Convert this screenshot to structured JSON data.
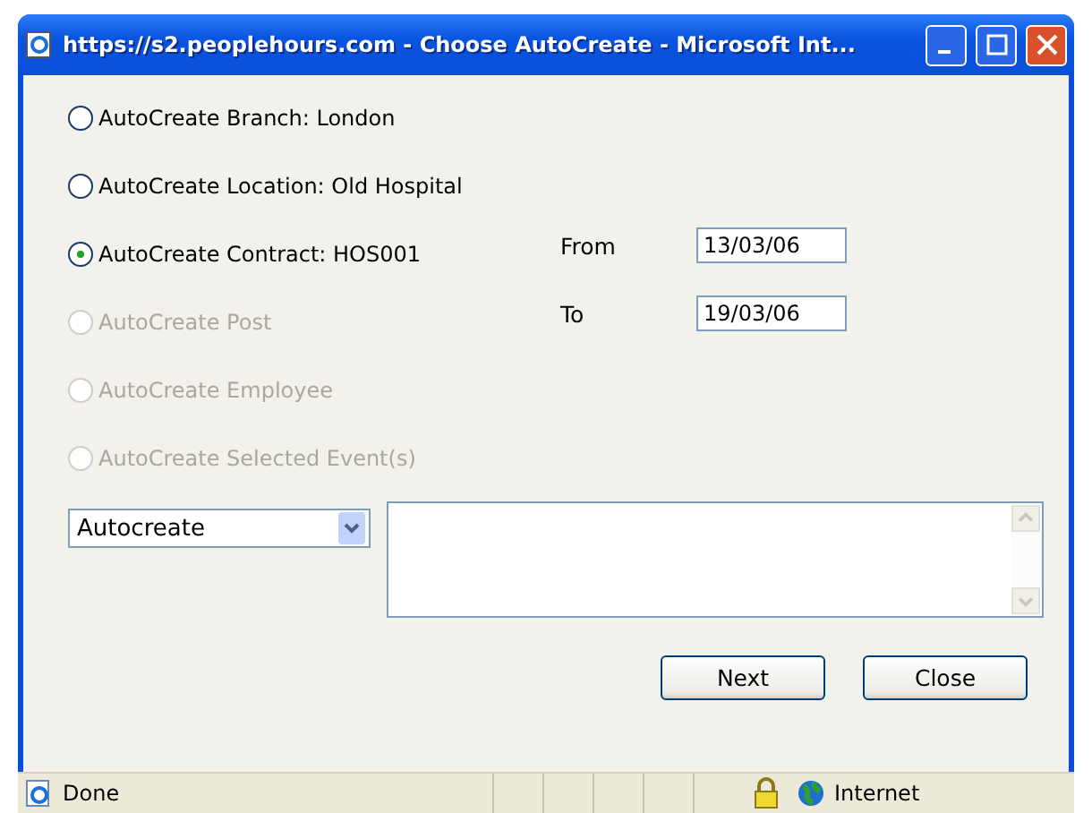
{
  "window": {
    "title": "https://s2.peoplehours.com - Choose AutoCreate - Microsoft Int..."
  },
  "options": [
    {
      "label": "AutoCreate Branch: London",
      "selected": false,
      "disabled": false
    },
    {
      "label": "AutoCreate Location: Old Hospital",
      "selected": false,
      "disabled": false
    },
    {
      "label": "AutoCreate Contract: HOS001",
      "selected": true,
      "disabled": false
    },
    {
      "label": "AutoCreate Post",
      "selected": false,
      "disabled": true
    },
    {
      "label": "AutoCreate Employee",
      "selected": false,
      "disabled": true
    },
    {
      "label": "AutoCreate Selected Event(s)",
      "selected": false,
      "disabled": true
    }
  ],
  "date_fields": [
    {
      "label": "From",
      "value": "13/03/06"
    },
    {
      "label": "To",
      "value": "19/03/06"
    }
  ],
  "dropdown": {
    "value": "Autocreate"
  },
  "buttons": [
    "Next",
    "Close"
  ],
  "status_bar": {
    "status": "Done",
    "zone": "Internet"
  }
}
